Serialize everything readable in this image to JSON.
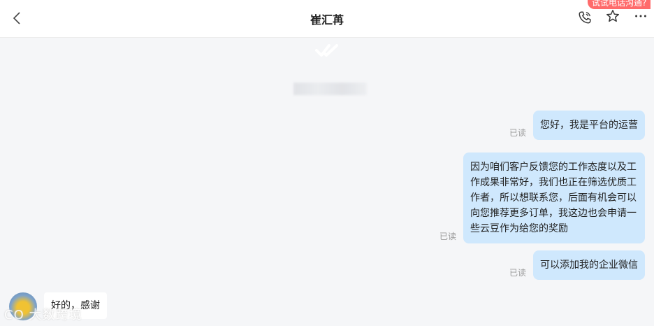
{
  "header": {
    "title": "崔汇苒",
    "call_tooltip": "试试电话沟通?"
  },
  "messages": [
    {
      "direction": "out",
      "text": "您好，我是平台的运营",
      "status": "已读"
    },
    {
      "direction": "out",
      "text": "因为咱们客户反馈您的工作态度以及工作成果非常好，我们也正在筛选优质工作者，所以想联系您，后面有机会可以向您推荐更多订单，我这边也会申请一些云豆作为给您的奖励",
      "status": "已读"
    },
    {
      "direction": "out",
      "text": "可以添加我的企业微信",
      "status": "已读"
    },
    {
      "direction": "in",
      "text": "好的，感谢"
    }
  ],
  "watermark": "CO 大数跨境",
  "colors": {
    "outgoing_bubble": "#cfe8fd",
    "incoming_bubble": "#ffffff",
    "tooltip": "#ff6b6b",
    "background": "#f5f6f8"
  },
  "icons": [
    "back-arrow-icon",
    "phone-icon",
    "star-icon",
    "more-icon",
    "double-check-icon"
  ]
}
